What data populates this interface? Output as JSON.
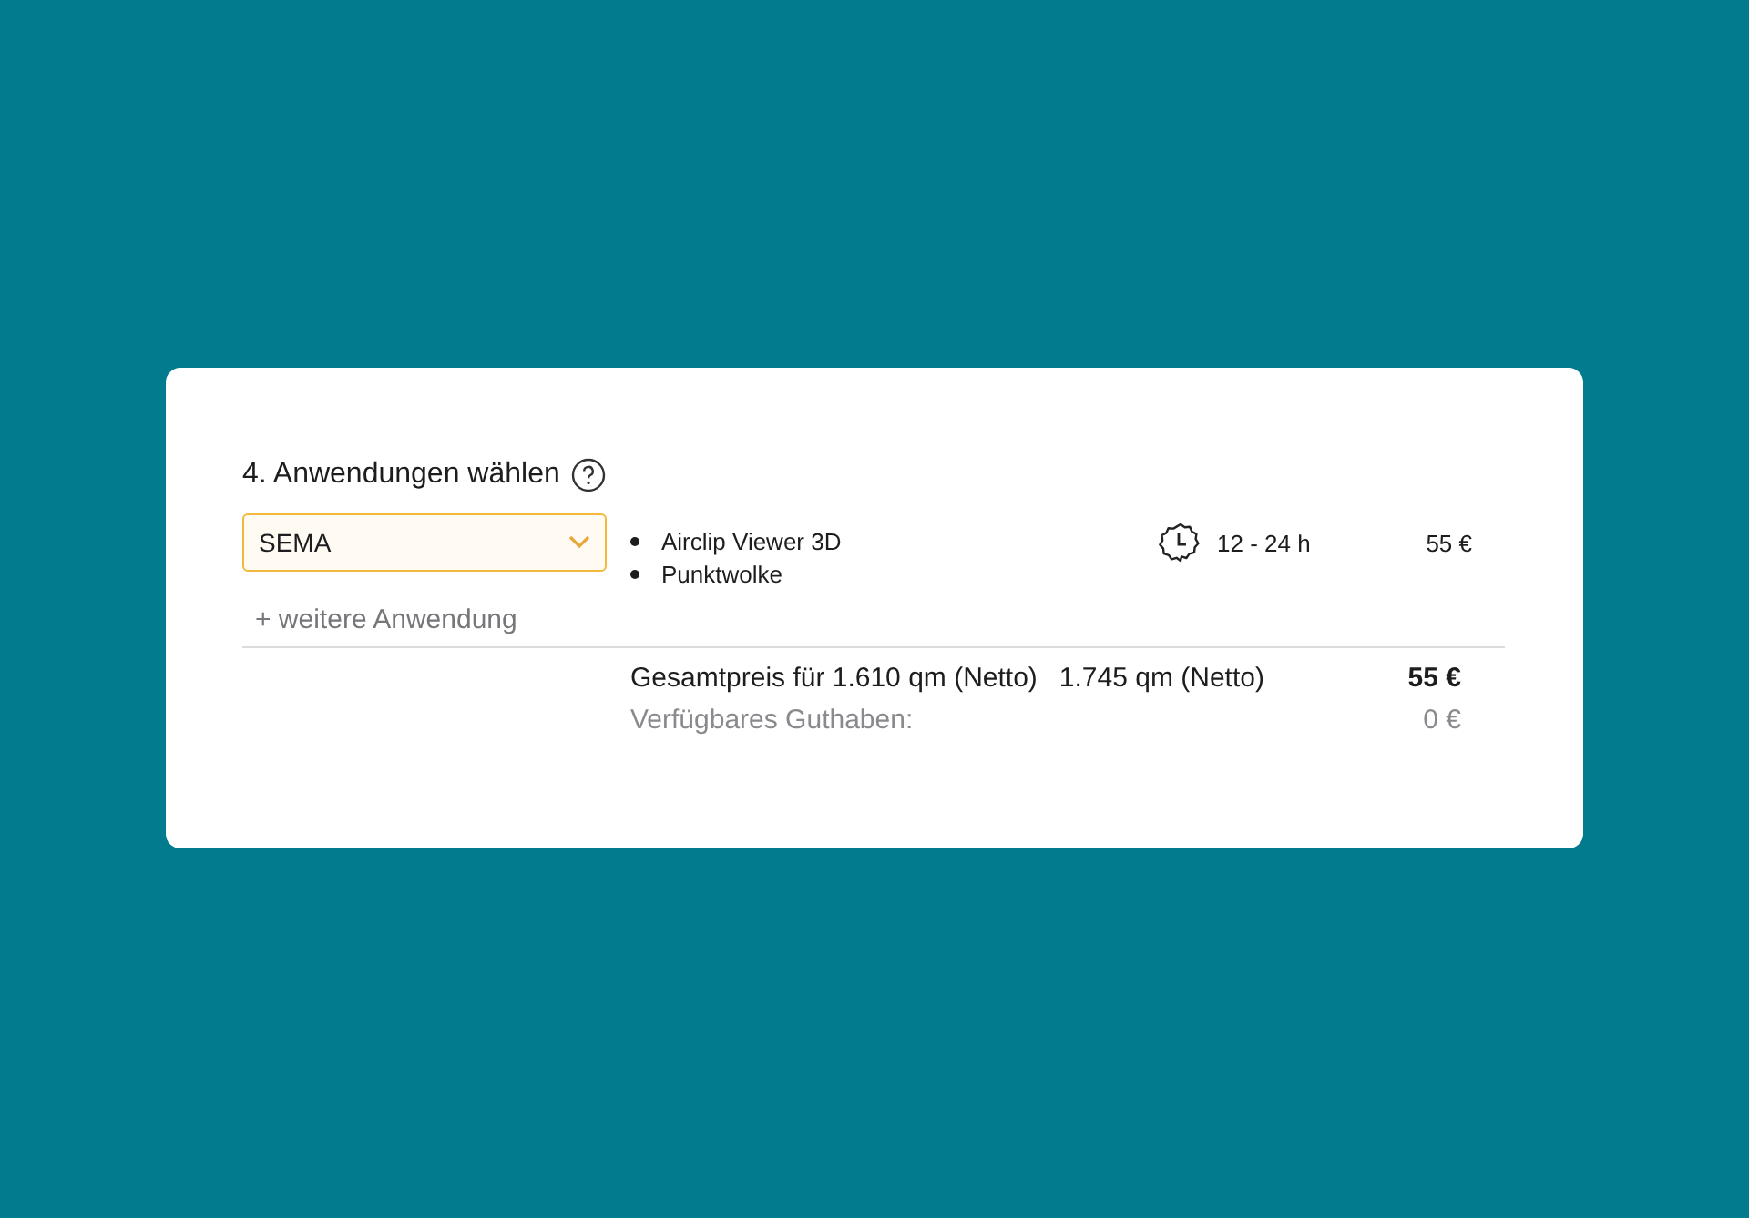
{
  "section": {
    "title": "4. Anwendungen wählen"
  },
  "application": {
    "value": "SEMA",
    "features": [
      "Airclip Viewer 3D",
      "Punktwolke"
    ],
    "duration": "12 - 24 h",
    "price": "55 €"
  },
  "add_link": "+ weitere Anwendung",
  "summary": {
    "total_label": "Gesamtpreis für 1.610 qm (Netto)",
    "area": "1.745 qm (Netto)",
    "total": "55 €",
    "credit_label": "Verfügbares Guthaben:",
    "credit": "0 €"
  }
}
